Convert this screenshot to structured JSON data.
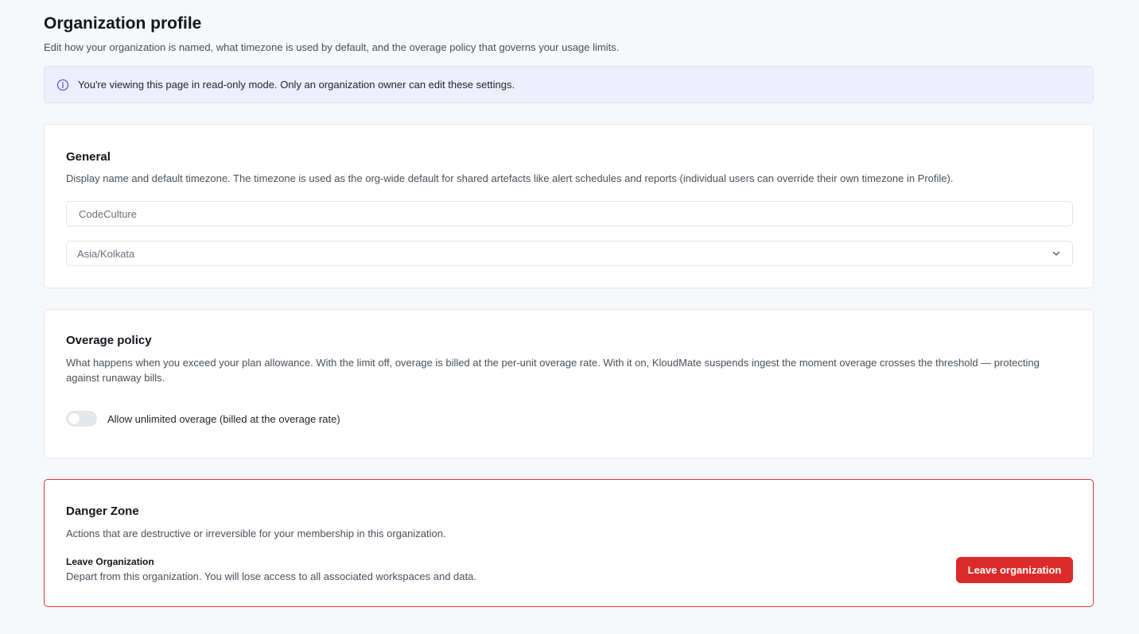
{
  "header": {
    "title": "Organization profile",
    "subtitle": "Edit how your organization is named, what timezone is used by default, and the overage policy that governs your usage limits."
  },
  "notice": {
    "icon": "info-icon",
    "text": "You're viewing this page in read-only mode. Only an organization owner can edit these settings."
  },
  "general": {
    "title": "General",
    "description": "Display name and default timezone. The timezone is used as the org-wide default for shared artefacts like alert schedules and reports (individual users can override their own timezone in Profile).",
    "name_value": "CodeCulture",
    "timezone_value": "Asia/Kolkata"
  },
  "overage": {
    "title": "Overage policy",
    "description": "What happens when you exceed your plan allowance. With the limit off, overage is billed at the per-unit overage rate. With it on, KloudMate suspends ingest the moment overage crosses the threshold — protecting against runaway bills.",
    "toggle_label": "Allow unlimited overage (billed at the overage rate)",
    "toggle_on": false
  },
  "danger": {
    "title": "Danger Zone",
    "description": "Actions that are destructive or irreversible for your membership in this organization.",
    "leave_title": "Leave Organization",
    "leave_description": "Depart from this organization. You will lose access to all associated workspaces and data.",
    "leave_button": "Leave organization"
  },
  "colors": {
    "accent": "#5b5bd6",
    "danger": "#dc2a2a",
    "notice_bg": "#eeeefc"
  }
}
